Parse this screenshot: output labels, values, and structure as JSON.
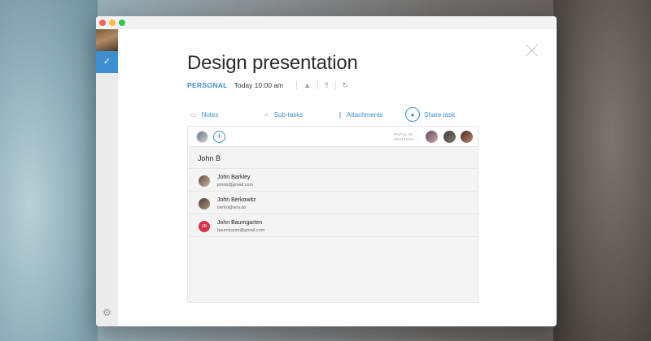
{
  "task": {
    "title": "Design presentation",
    "list": "PERSONAL",
    "due": "Today 10:00 am"
  },
  "tabs": {
    "notes": "Notes",
    "subtasks": "Sub-tasks",
    "attachments": "Attachments",
    "share": "Share task"
  },
  "members": {
    "popular_line1": "POPULAR",
    "popular_line2": "MEMBERS"
  },
  "search": {
    "value": "John B"
  },
  "results": [
    {
      "name": "John Barkley",
      "email": "johnb@gmail.com",
      "initials": ""
    },
    {
      "name": "John Berkowitz",
      "email": "berko@any.do",
      "initials": ""
    },
    {
      "name": "John Baumgarten",
      "email": "baumbaum@gmail.com",
      "initials": "JB"
    }
  ],
  "colors": {
    "accent": "#3d8fd1",
    "initials_avatar": "#d6334b"
  },
  "icons": {
    "close": "close-icon",
    "check": "check-icon",
    "settings": "gear-icon"
  }
}
